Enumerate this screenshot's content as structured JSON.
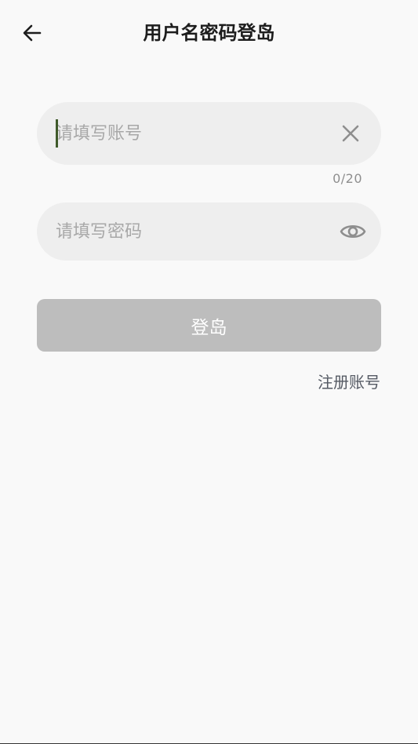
{
  "header": {
    "back_icon": "arrow-left-icon",
    "title": "用户名密码登岛"
  },
  "form": {
    "account": {
      "value": "",
      "placeholder": "请填写账号",
      "counter": "0/20",
      "clear_icon": "close-icon"
    },
    "password": {
      "value": "",
      "placeholder": "请填写密码",
      "visibility_icon": "eye-icon"
    },
    "login_label": "登岛",
    "register_label": "注册账号"
  },
  "colors": {
    "background": "#f9f9f9",
    "field_background": "#eeeeee",
    "button_disabled": "#bdbdbd",
    "caret": "#3f5a2a",
    "link": "#555a64"
  }
}
